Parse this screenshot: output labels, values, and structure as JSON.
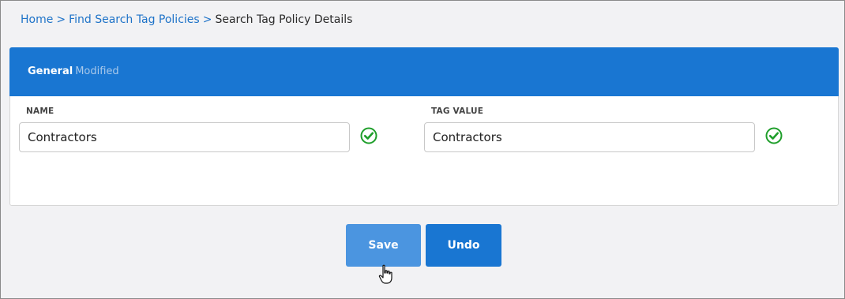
{
  "breadcrumb": {
    "home": "Home",
    "separator": ">",
    "find": "Find Search Tag Policies",
    "current": "Search Tag Policy Details"
  },
  "panel": {
    "title": "General",
    "status": "Modified"
  },
  "fields": {
    "name_label": "NAME",
    "name_value": "Contractors",
    "tag_label": "TAG VALUE",
    "tag_value": "Contractors"
  },
  "buttons": {
    "save": "Save",
    "undo": "Undo"
  },
  "colors": {
    "header_blue": "#1976d2",
    "save_blue": "#4b95e0",
    "check_green": "#1e9e2a",
    "link_blue": "#1e73c8"
  },
  "icons": {
    "valid": "check-circle-icon",
    "cursor": "hand-pointer-icon"
  }
}
